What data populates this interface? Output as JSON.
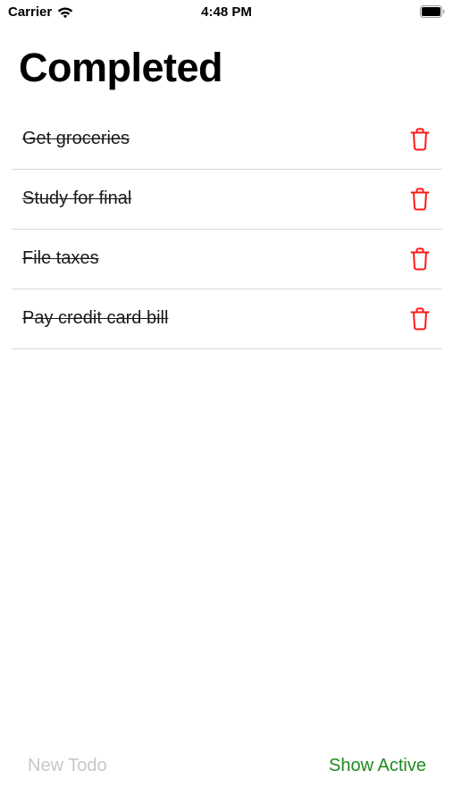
{
  "status_bar": {
    "carrier": "Carrier",
    "time": "4:48 PM",
    "wifi_icon": "wifi-icon",
    "battery_icon": "battery-icon"
  },
  "page": {
    "title": "Completed"
  },
  "todos": [
    {
      "label": "Get groceries",
      "completed": true,
      "action_icon": "trash-icon"
    },
    {
      "label": "Study for final",
      "completed": true,
      "action_icon": "trash-icon"
    },
    {
      "label": "File taxes",
      "completed": true,
      "action_icon": "trash-icon"
    },
    {
      "label": "Pay credit card bill",
      "completed": true,
      "action_icon": "trash-icon"
    }
  ],
  "toolbar": {
    "new_todo_label": "New Todo",
    "new_todo_enabled": false,
    "show_active_label": "Show Active"
  },
  "colors": {
    "delete": "#ff1a1a",
    "accent_green": "#1f8a1f",
    "disabled_gray": "#c7c7cc",
    "separator": "#d9d9d9"
  }
}
